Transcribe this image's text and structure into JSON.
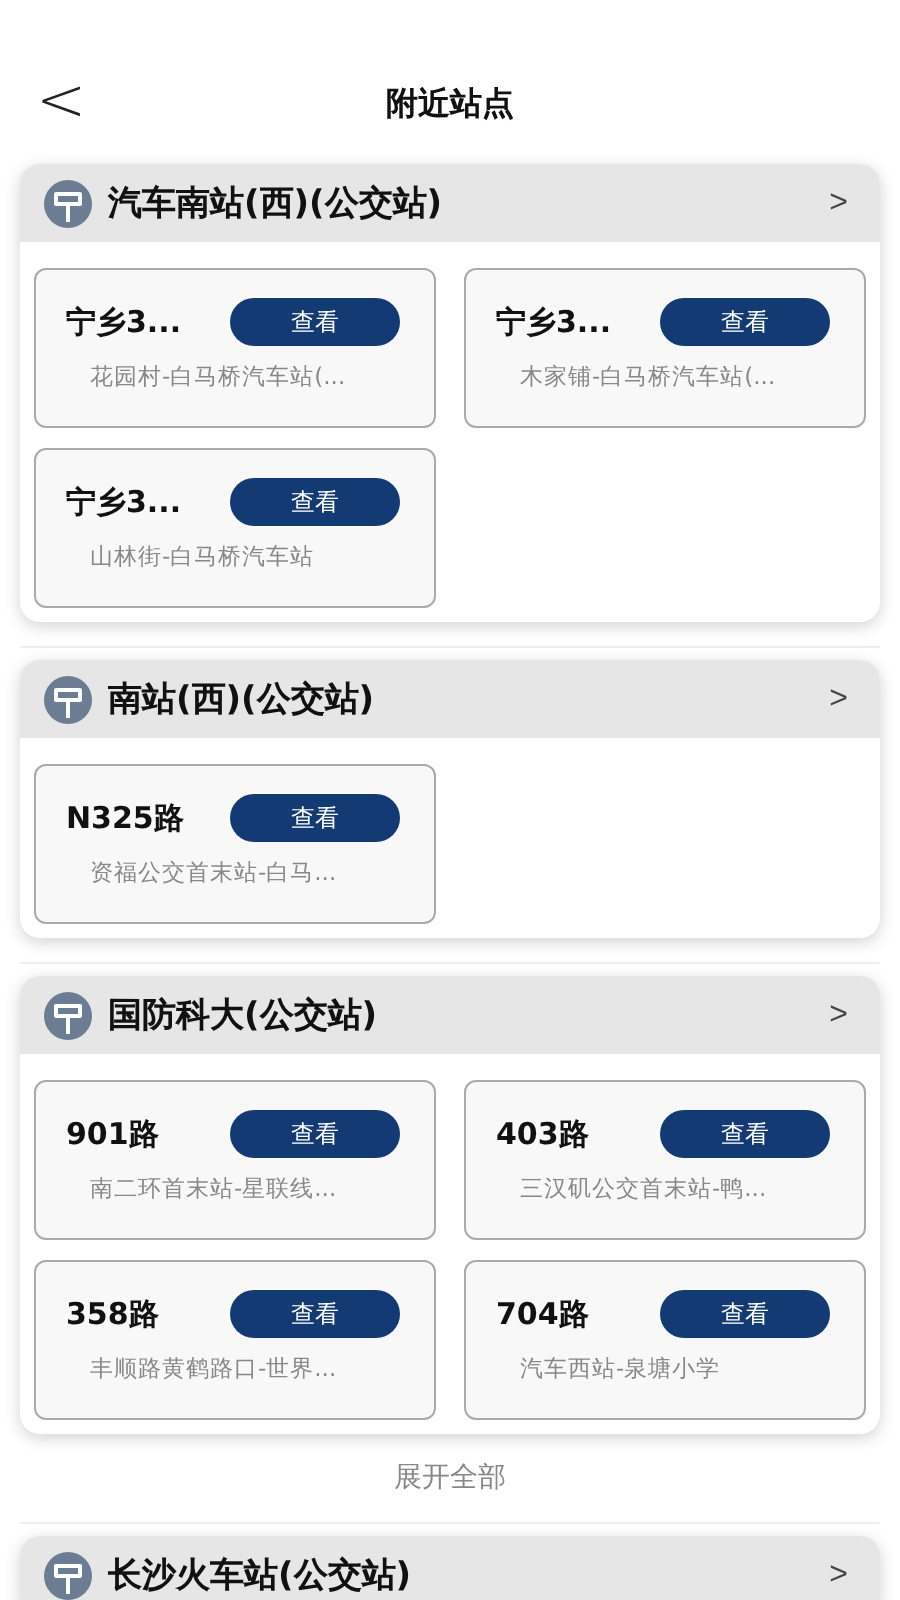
{
  "header": {
    "back": "<",
    "title": "附近站点"
  },
  "stations": [
    {
      "name": "汽车南站(西)(公交站)",
      "chevron": ">",
      "routes": [
        {
          "route": "宁乡3...",
          "button": "查看",
          "stops": "花园村-白马桥汽车站(..."
        },
        {
          "route": "宁乡3...",
          "button": "查看",
          "stops": "木家铺-白马桥汽车站(..."
        },
        {
          "route": "宁乡3...",
          "button": "查看",
          "stops": "山林街-白马桥汽车站"
        }
      ]
    },
    {
      "name": "南站(西)(公交站)",
      "chevron": ">",
      "routes": [
        {
          "route": "N325路",
          "button": "查看",
          "stops": "资福公交首末站-白马..."
        }
      ]
    },
    {
      "name": "国防科大(公交站)",
      "chevron": ">",
      "routes": [
        {
          "route": "901路",
          "button": "查看",
          "stops": "南二环首末站-星联线..."
        },
        {
          "route": "403路",
          "button": "查看",
          "stops": "三汉矶公交首末站-鸭..."
        },
        {
          "route": "358路",
          "button": "查看",
          "stops": "丰顺路黄鹤路口-世界..."
        },
        {
          "route": "704路",
          "button": "查看",
          "stops": "汽车西站-泉塘小学"
        }
      ],
      "expand": "展开全部"
    },
    {
      "name": "长沙火车站(公交站)",
      "chevron": ">"
    }
  ]
}
